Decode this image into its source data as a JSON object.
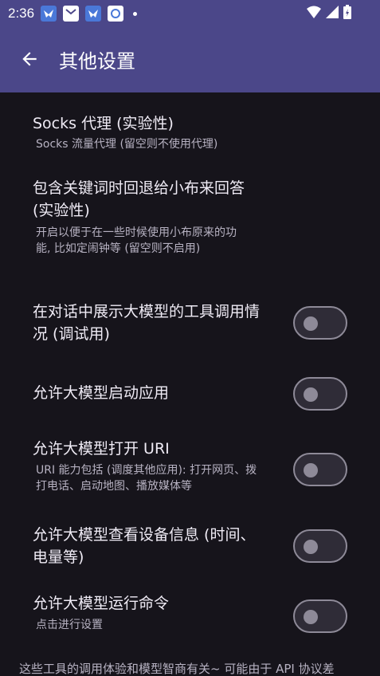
{
  "status": {
    "time": "2:36"
  },
  "header": {
    "title": "其他设置"
  },
  "settings": [
    {
      "title": "Socks 代理 (实验性)",
      "subtitle": "Socks 流量代理 (留空则不使用代理)"
    },
    {
      "title": "包含关键词时回退给小布来回答 (实验性)",
      "subtitle": "开启以便于在一些时候使用小布原来的功能, 比如定闹钟等 (留空则不启用)"
    },
    {
      "title": "在对话中展示大模型的工具调用情况 (调试用)",
      "subtitle": "",
      "toggle": false
    },
    {
      "title": "允许大模型启动应用",
      "subtitle": "",
      "toggle": false
    },
    {
      "title": "允许大模型打开 URI",
      "subtitle": "URI 能力包括 (调度其他应用): 打开网页、拨打电话、启动地图、播放媒体等",
      "toggle": false
    },
    {
      "title": "允许大模型查看设备信息 (时间、电量等)",
      "subtitle": "",
      "toggle": false
    },
    {
      "title": "允许大模型运行命令",
      "subtitle": "点击进行设置",
      "toggle": false
    }
  ],
  "footer": {
    "note": "这些工具的调用体验和模型智商有关~ 可能由于 API 协议差"
  },
  "colors": {
    "appbar": "#4b4789",
    "background": "#16141b"
  }
}
